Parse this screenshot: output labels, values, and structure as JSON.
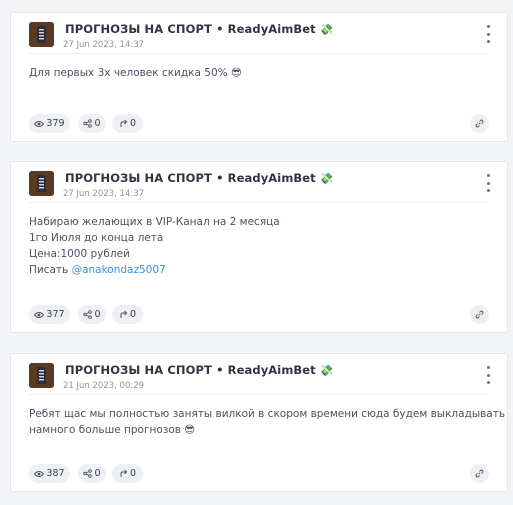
{
  "posts": [
    {
      "channel_name": "ПРОГНОЗЫ НА СПОРТ • ReadyAimBet",
      "channel_emoji": "💸",
      "date": "27 Jun 2023, 14:37",
      "lines": [
        "Для первых 3х человек скидка 50% 😎"
      ],
      "views": "379",
      "shares": "0",
      "forwards": "0"
    },
    {
      "channel_name": "ПРОГНОЗЫ НА СПОРТ • ReadyAimBet",
      "channel_emoji": "💸",
      "date": "27 Jun 2023, 14:37",
      "lines": [
        "Набираю желающих в VIP-Канал на 2 месяца",
        "1го Июля до конца лета",
        "Цена:1000 рублей"
      ],
      "contact_prefix": "Писать ",
      "contact_link": "@anakondaz5007",
      "views": "377",
      "shares": "0",
      "forwards": "0"
    },
    {
      "channel_name": "ПРОГНОЗЫ НА СПОРТ • ReadyAimBet",
      "channel_emoji": "💸",
      "date": "21 Jun 2023, 00:29",
      "lines": [
        "Ребят щас мы полностью заняты вилкой в скором времени сюда будем выкладывать",
        "намного больше прогнозов 😎"
      ],
      "views": "387",
      "shares": "0",
      "forwards": "0"
    }
  ],
  "icons": {
    "views": "eye-icon",
    "shares": "share-nodes-icon",
    "forwards": "forward-arrow-icon",
    "link": "link-icon",
    "menu": "more-vertical-icon"
  },
  "colors": {
    "link": "#3f8fd6",
    "pill_bg": "#eef0f3",
    "page_bg": "#f3f4f6"
  }
}
